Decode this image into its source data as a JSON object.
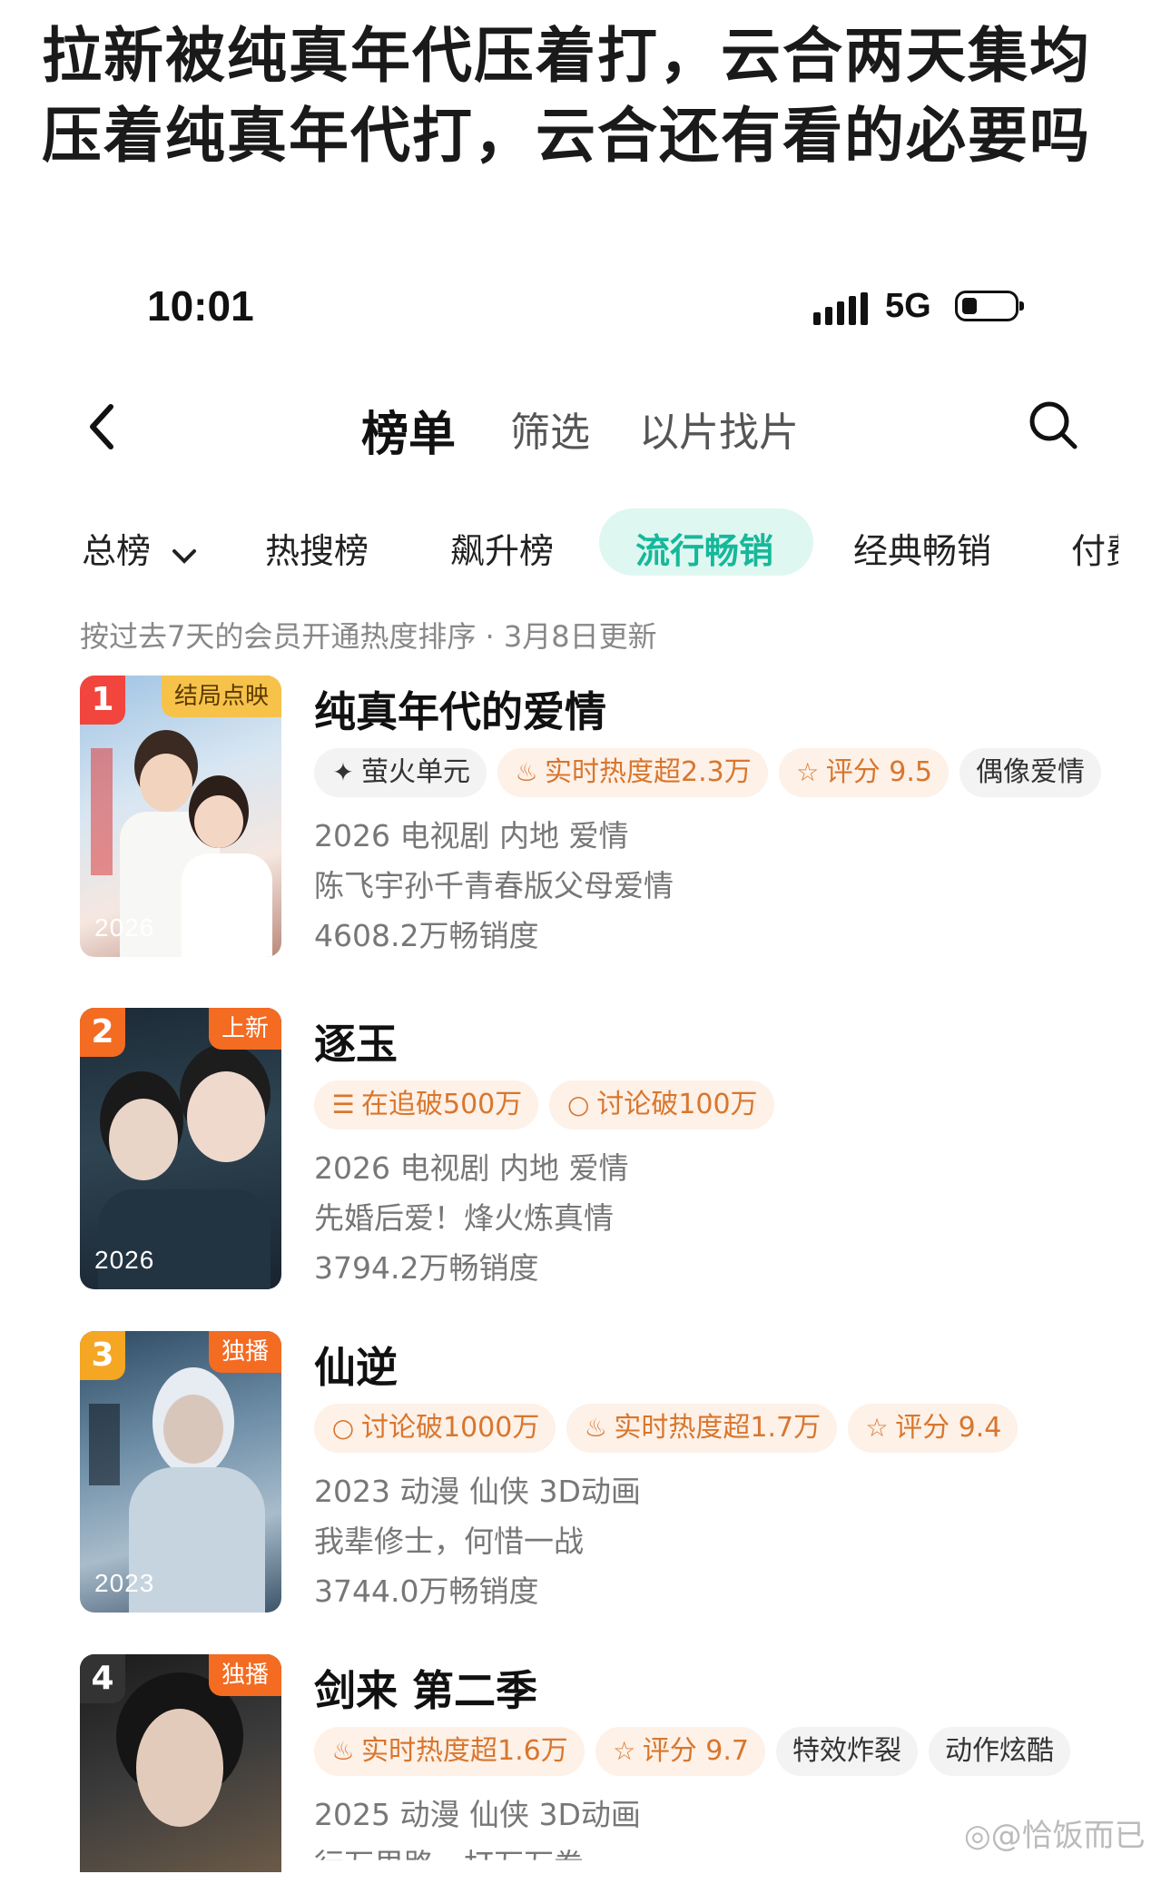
{
  "headline": {
    "line1": "拉新被纯真年代压着打，云合两天集均",
    "line2": "压着纯真年代打，云合还有看的必要吗"
  },
  "status": {
    "time": "10:01",
    "network": "5G"
  },
  "nav": {
    "title": "榜单",
    "tabs": [
      "筛选",
      "以片找片"
    ]
  },
  "categories": {
    "dropdown": "总榜",
    "items": [
      "热搜榜",
      "飙升榜",
      "流行畅销",
      "经典畅销",
      "付费"
    ],
    "active": "流行畅销"
  },
  "subtitle": "按过去7天的会员开通热度排序 · 3月8日更新",
  "items": [
    {
      "rank": "1",
      "badge": "结局点映",
      "year": "2026",
      "title": "纯真年代的爱情",
      "tags": [
        {
          "text": "萤火单元",
          "icon": "brand-logo",
          "style": "plain"
        },
        {
          "text": "实时热度超2.3万",
          "icon": "flame-icon",
          "style": "warm"
        },
        {
          "text": "评分 9.5",
          "icon": "star-icon",
          "style": "warm"
        },
        {
          "text": "偶像爱情",
          "icon": "",
          "style": "plain"
        }
      ],
      "info": "2026 电视剧 内地 爱情",
      "desc": "陈飞宇孙千青春版父母爱情",
      "sales": "4608.2万畅销度"
    },
    {
      "rank": "2",
      "badge": "上新",
      "year": "2026",
      "title": "逐玉",
      "tags": [
        {
          "text": "在追破500万",
          "icon": "list-icon",
          "style": "warm"
        },
        {
          "text": "讨论破100万",
          "icon": "comment-icon",
          "style": "warm"
        }
      ],
      "info": "2026 电视剧 内地 爱情",
      "desc": "先婚后爱！烽火炼真情",
      "sales": "3794.2万畅销度"
    },
    {
      "rank": "3",
      "badge": "独播",
      "year": "2023",
      "title": "仙逆",
      "tags": [
        {
          "text": "讨论破1000万",
          "icon": "comment-icon",
          "style": "warm"
        },
        {
          "text": "实时热度超1.7万",
          "icon": "flame-icon",
          "style": "warm"
        },
        {
          "text": "评分 9.4",
          "icon": "star-icon",
          "style": "warm"
        }
      ],
      "info": "2023 动漫 仙侠 3D动画",
      "desc": "我辈修士，何惜一战",
      "sales": "3744.0万畅销度"
    },
    {
      "rank": "4",
      "badge": "独播",
      "year": "",
      "title": "剑来 第二季",
      "tags": [
        {
          "text": "实时热度超1.6万",
          "icon": "flame-icon",
          "style": "warm"
        },
        {
          "text": "评分 9.7",
          "icon": "star-icon",
          "style": "warm"
        },
        {
          "text": "特效炸裂",
          "icon": "",
          "style": "plain"
        },
        {
          "text": "动作炫酷",
          "icon": "",
          "style": "plain"
        }
      ],
      "info": "2025 动漫 仙侠 3D动画",
      "desc": "行万里路，打万万拳",
      "sales": ""
    }
  ],
  "watermark": "@恰饭而已",
  "colors": {
    "accent": "#16b89a",
    "rank1": "#f2453d",
    "rank2": "#f46b22",
    "rank3": "#f5a623",
    "rank4": "#333333",
    "badge": "#f5a623"
  }
}
